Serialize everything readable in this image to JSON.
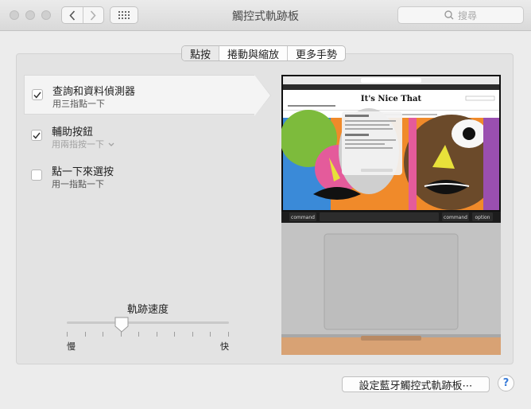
{
  "window": {
    "title": "觸控式軌跡板"
  },
  "search": {
    "placeholder": "搜尋"
  },
  "tabs": [
    {
      "label": "點按",
      "active": true
    },
    {
      "label": "捲動與縮放",
      "active": false
    },
    {
      "label": "更多手勢",
      "active": false
    }
  ],
  "options": [
    {
      "title": "查詢和資料偵測器",
      "subtitle": "用三指點一下",
      "checked": true,
      "selected": true
    },
    {
      "title": "輔助按鈕",
      "subtitle": "用兩指按一下",
      "checked": true,
      "selected": false,
      "has_dropdown": true
    },
    {
      "title": "點一下來選按",
      "subtitle": "用一指點一下",
      "checked": false,
      "selected": false
    }
  ],
  "tracking_speed": {
    "label": "軌跡速度",
    "min_label": "慢",
    "max_label": "快",
    "value": 0.34,
    "tick_count": 10
  },
  "preview": {
    "site_name": "It's Nice That",
    "keys": [
      "command",
      "command",
      "option"
    ]
  },
  "bluetooth_button": {
    "label": "設定藍牙觸控式軌跡板⋯"
  },
  "help_button": {
    "label": "?"
  }
}
